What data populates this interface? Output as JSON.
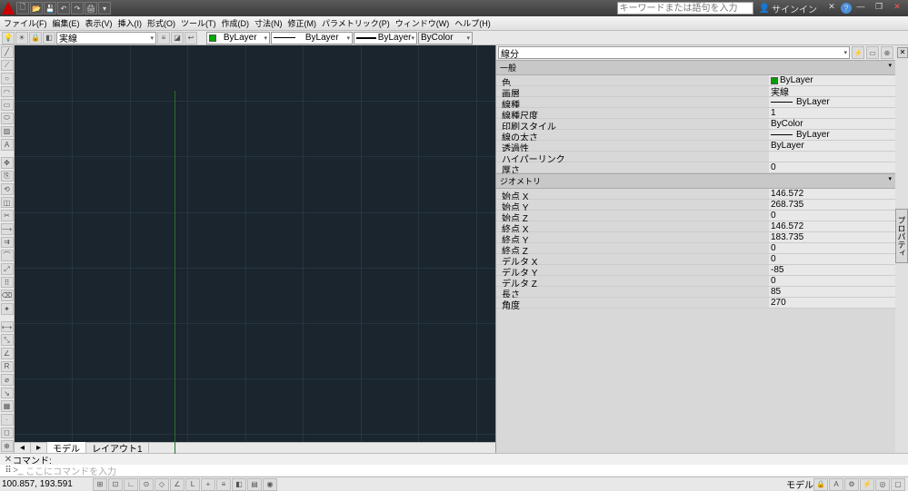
{
  "titlebar": {
    "search_placeholder": "キーワードまたは語句を入力",
    "signin": "サインイン"
  },
  "menu": [
    "ファイル(F)",
    "編集(E)",
    "表示(V)",
    "挿入(I)",
    "形式(O)",
    "ツール(T)",
    "作成(D)",
    "寸法(N)",
    "修正(M)",
    "パラメトリック(P)",
    "ウィンドウ(W)",
    "ヘルプ(H)"
  ],
  "layer_combo": "実線",
  "props_toolbar": {
    "layer": "ByLayer",
    "linetype": "ByLayer",
    "lineweight": "ByLayer",
    "plotstyle": "ByColor"
  },
  "tabs": {
    "model": "モデル",
    "layout1": "レイアウト1"
  },
  "properties": {
    "selector": "線分",
    "panel_label": "プロパティ",
    "section_general": "一般",
    "general": [
      {
        "k": "色",
        "v": "ByLayer",
        "swatch": "#00a000"
      },
      {
        "k": "画層",
        "v": "実線"
      },
      {
        "k": "線種",
        "v": "ByLayer",
        "line": true
      },
      {
        "k": "線種尺度",
        "v": "1"
      },
      {
        "k": "印刷スタイル",
        "v": "ByColor"
      },
      {
        "k": "線の太さ",
        "v": "ByLayer",
        "line": true
      },
      {
        "k": "透過性",
        "v": "ByLayer"
      },
      {
        "k": "ハイパーリンク",
        "v": ""
      },
      {
        "k": "厚さ",
        "v": "0"
      }
    ],
    "section_geometry": "ジオメトリ",
    "geometry": [
      {
        "k": "始点 X",
        "v": "146.572"
      },
      {
        "k": "始点 Y",
        "v": "268.735"
      },
      {
        "k": "始点 Z",
        "v": "0"
      },
      {
        "k": "終点 X",
        "v": "146.572"
      },
      {
        "k": "終点 Y",
        "v": "183.735"
      },
      {
        "k": "終点 Z",
        "v": "0"
      },
      {
        "k": "デルタ X",
        "v": "0"
      },
      {
        "k": "デルタ Y",
        "v": "-85"
      },
      {
        "k": "デルタ Z",
        "v": "0"
      },
      {
        "k": "長さ",
        "v": "85"
      },
      {
        "k": "角度",
        "v": "270"
      }
    ]
  },
  "command": {
    "label": "コマンド:",
    "prompt_prefix": ">_",
    "prompt": "ここにコマンドを入力"
  },
  "status": {
    "coords": "100.857, 193.591",
    "model": "モデル"
  }
}
